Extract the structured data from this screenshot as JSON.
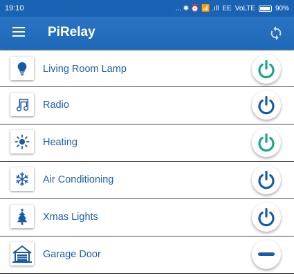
{
  "status_bar": {
    "time": "19:10",
    "indicators": "... ✱ ⏰ 📶 .ıll",
    "carrier": "EE",
    "network": "VoLTE",
    "battery": "90%"
  },
  "app_bar": {
    "title": "PiRelay",
    "menu_icon": "menu-icon",
    "action_icon": "refresh-icon"
  },
  "colors": {
    "primary": "#2a74c3",
    "on": "#1aa58a",
    "off": "#1a5aa5",
    "label": "#1e5ea8"
  },
  "devices": [
    {
      "label": "Living Room Lamp",
      "icon": "lightbulb-icon",
      "state": "on"
    },
    {
      "label": "Radio",
      "icon": "music-note-icon",
      "state": "off"
    },
    {
      "label": "Heating",
      "icon": "sun-icon",
      "state": "on"
    },
    {
      "label": "Air Conditioning",
      "icon": "snowflake-icon",
      "state": "off"
    },
    {
      "label": "Xmas Lights",
      "icon": "christmas-tree-icon",
      "state": "off"
    },
    {
      "label": "Garage Door",
      "icon": "garage-icon",
      "state": "momentary"
    }
  ]
}
